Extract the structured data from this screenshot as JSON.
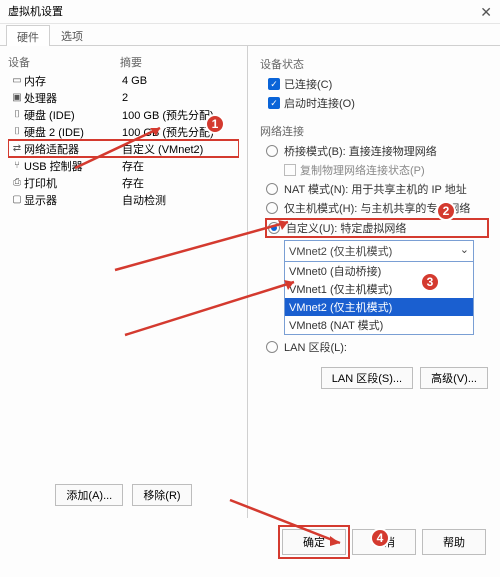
{
  "title": "虚拟机设置",
  "tabs": {
    "hw": "硬件",
    "opt": "选项"
  },
  "left": {
    "hdr1": "设备",
    "hdr2": "摘要",
    "rows": [
      {
        "ico": "▭",
        "name": "内存",
        "sum": "4 GB"
      },
      {
        "ico": "▣",
        "name": "处理器",
        "sum": "2"
      },
      {
        "ico": "⌷",
        "name": "硬盘 (IDE)",
        "sum": "100 GB (预先分配)"
      },
      {
        "ico": "⌷",
        "name": "硬盘 2 (IDE)",
        "sum": "100 GB (预先分配)"
      },
      {
        "ico": "⇄",
        "name": "网络适配器",
        "sum": "自定义 (VMnet2)",
        "sel": true
      },
      {
        "ico": "⑂",
        "name": "USB 控制器",
        "sum": "存在"
      },
      {
        "ico": "⎙",
        "name": "打印机",
        "sum": "存在"
      },
      {
        "ico": "▢",
        "name": "显示器",
        "sum": "自动检测"
      }
    ],
    "add": "添加(A)...",
    "rem": "移除(R)"
  },
  "status": {
    "hdr": "设备状态",
    "connected": "已连接(C)",
    "onstart": "启动时连接(O)"
  },
  "net": {
    "hdr": "网络连接",
    "bridge": "桥接模式(B): 直接连接物理网络",
    "replicate": "复制物理网络连接状态(P)",
    "nat": "NAT 模式(N): 用于共享主机的 IP 地址",
    "host": "仅主机模式(H): 与主机共享的专用网络",
    "custom": "自定义(U): 特定虚拟网络",
    "dd_val": "VMnet2 (仅主机模式)",
    "opts": [
      "VMnet0 (自动桥接)",
      "VMnet1 (仅主机模式)",
      "VMnet2 (仅主机模式)",
      "VMnet8 (NAT 模式)"
    ],
    "lanseg": "LAN 区段(L):",
    "lanbtn": "LAN 区段(S)...",
    "advbtn": "高级(V)..."
  },
  "footer": {
    "ok": "确定",
    "cancel": "取消",
    "help": "帮助"
  },
  "anno": {
    "a1": "1",
    "a2": "2",
    "a3": "3",
    "a4": "4"
  }
}
